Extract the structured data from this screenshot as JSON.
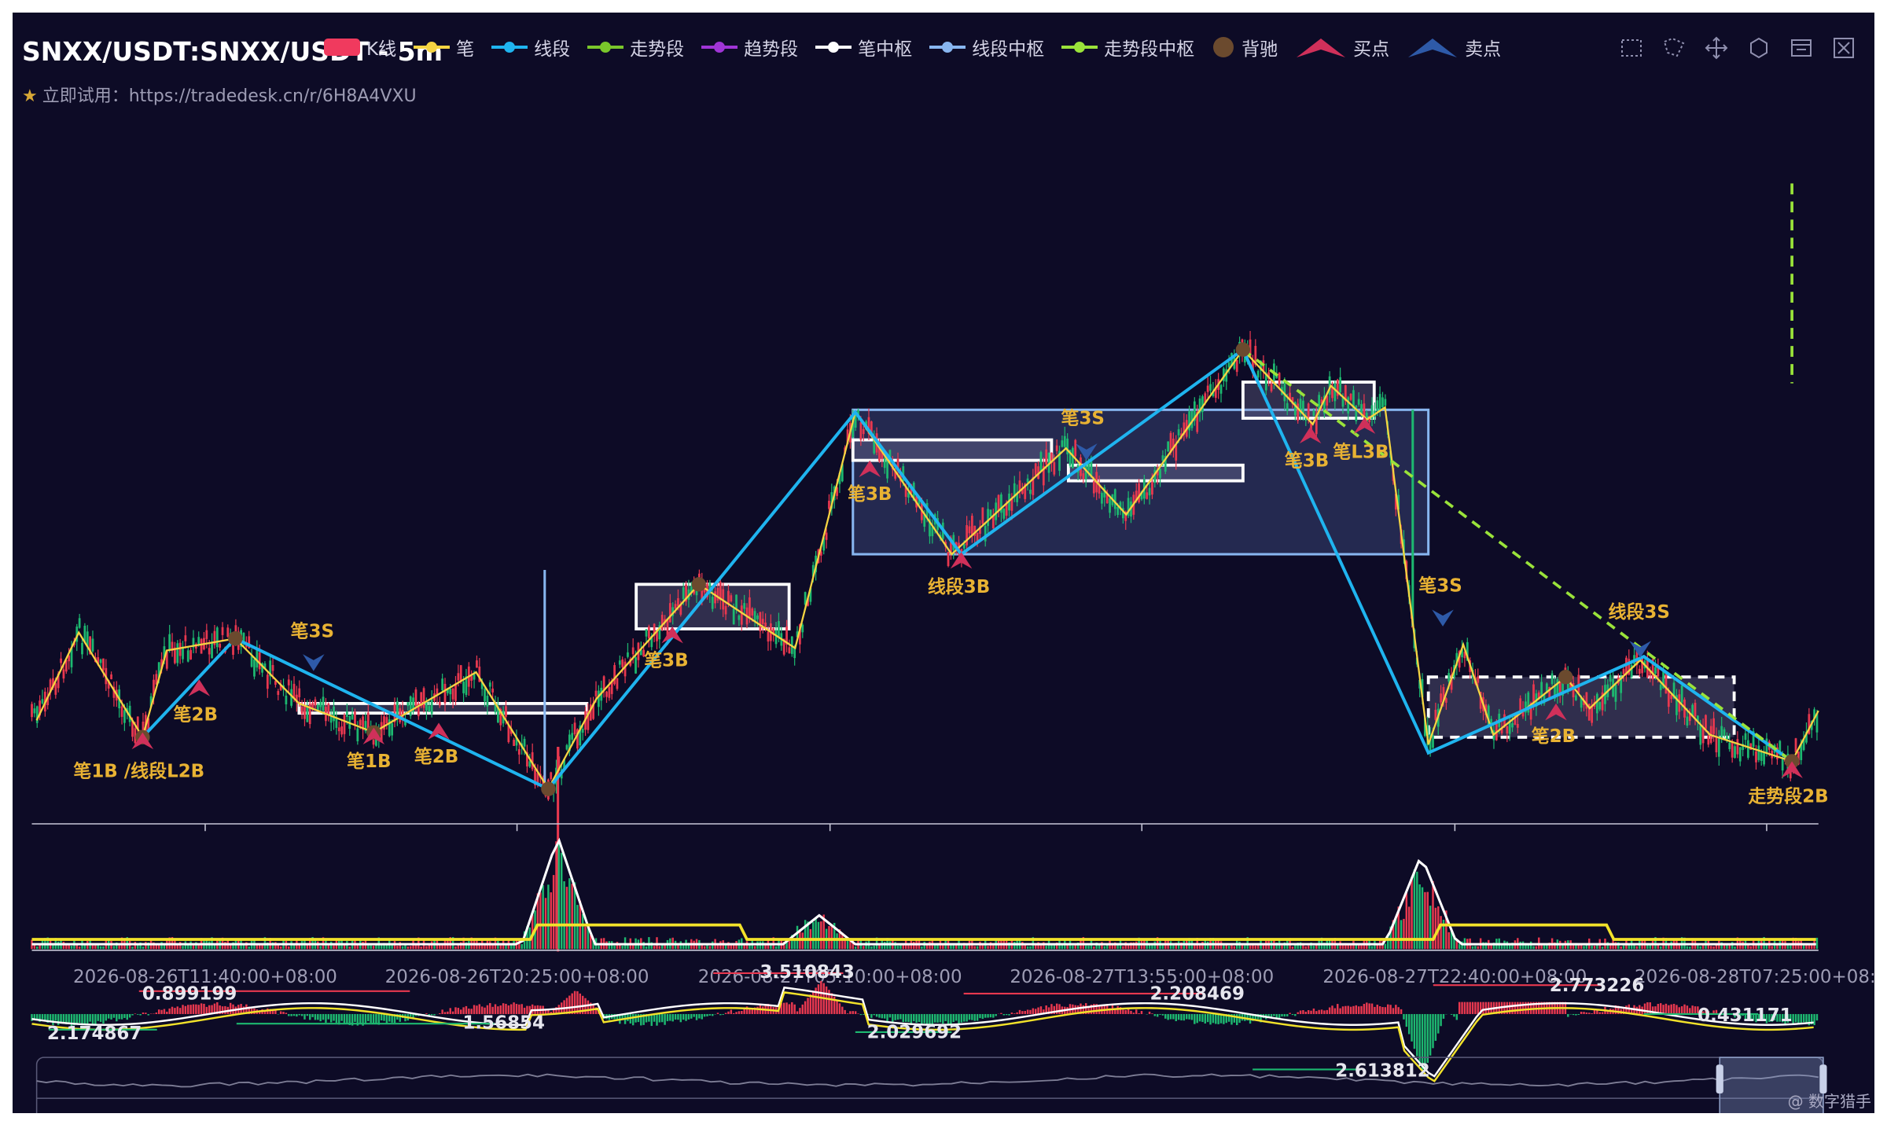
{
  "title": "SNXX/USDT:SNXX/USDT - 5m",
  "subtitle": "立即试用：https://tradedesk.cn/r/6H8A4VXU",
  "watermark": "@ 数字猎手",
  "legend": [
    {
      "label": "K线",
      "color": "#f03a5e",
      "shape": "rect"
    },
    {
      "label": "笔",
      "color": "#f5d442",
      "shape": "line"
    },
    {
      "label": "线段",
      "color": "#1fb4ef",
      "shape": "line"
    },
    {
      "label": "走势段",
      "color": "#7ac72b",
      "shape": "line"
    },
    {
      "label": "趋势段",
      "color": "#a035d6",
      "shape": "line"
    },
    {
      "label": "笔中枢",
      "color": "#ffffff",
      "shape": "line"
    },
    {
      "label": "线段中枢",
      "color": "#88b6f0",
      "shape": "line"
    },
    {
      "label": "走势段中枢",
      "color": "#9ae33a",
      "shape": "line"
    },
    {
      "label": "背驰",
      "color": "#6b4a2e",
      "shape": "dot"
    },
    {
      "label": "买点",
      "color": "#d0305a",
      "shape": "up"
    },
    {
      "label": "卖点",
      "color": "#2e5aa8",
      "shape": "down"
    }
  ],
  "toolbar": [
    {
      "name": "box-zoom-icon"
    },
    {
      "name": "lasso-icon"
    },
    {
      "name": "drag-icon"
    },
    {
      "name": "restore-icon"
    },
    {
      "name": "data-view-icon"
    },
    {
      "name": "clear-icon"
    }
  ],
  "chart_data": {
    "type": "candlestick",
    "x_ticks": [
      "2026-08-26T11:40:00+08:00",
      "2026-08-26T20:25:00+08:00",
      "2026-08-27T05:10:00+08:00",
      "2026-08-27T13:55:00+08:00",
      "2026-08-27T22:40:00+08:00",
      "2026-08-28T07:25:00+08:00"
    ],
    "bi": [
      [
        30,
        598
      ],
      [
        65,
        525
      ],
      [
        118,
        612
      ],
      [
        138,
        540
      ],
      [
        195,
        530
      ],
      [
        248,
        584
      ],
      [
        310,
        608
      ],
      [
        395,
        558
      ],
      [
        455,
        655
      ],
      [
        495,
        580
      ],
      [
        580,
        485
      ],
      [
        660,
        538
      ],
      [
        710,
        342
      ],
      [
        790,
        460
      ],
      [
        885,
        372
      ],
      [
        935,
        427
      ],
      [
        1032,
        290
      ],
      [
        1090,
        352
      ],
      [
        1105,
        320
      ],
      [
        1135,
        348
      ],
      [
        1150,
        338
      ],
      [
        1186,
        618
      ],
      [
        1215,
        535
      ],
      [
        1240,
        610
      ],
      [
        1300,
        562
      ],
      [
        1320,
        588
      ],
      [
        1362,
        548
      ],
      [
        1420,
        610
      ],
      [
        1488,
        632
      ],
      [
        1510,
        590
      ]
    ],
    "xianduan": [
      [
        118,
        612
      ],
      [
        195,
        530
      ],
      [
        455,
        655
      ],
      [
        710,
        342
      ],
      [
        798,
        460
      ],
      [
        1032,
        290
      ],
      [
        1186,
        625
      ],
      [
        1365,
        545
      ],
      [
        1488,
        632
      ]
    ],
    "zoushi_trend": [
      [
        1032,
        290
      ],
      [
        1488,
        632
      ]
    ],
    "bi_zhongshu": [
      {
        "x1": 248,
        "y1": 584,
        "x2": 487,
        "y2": 592,
        "dashed": false
      },
      {
        "x1": 528,
        "y1": 485,
        "x2": 655,
        "y2": 522,
        "dashed": false
      },
      {
        "x1": 708,
        "y1": 365,
        "x2": 873,
        "y2": 382,
        "dashed": false
      },
      {
        "x1": 887,
        "y1": 386,
        "x2": 1032,
        "y2": 399,
        "dashed": false
      },
      {
        "x1": 1032,
        "y1": 317,
        "x2": 1141,
        "y2": 347,
        "dashed": false
      },
      {
        "x1": 1186,
        "y1": 562,
        "x2": 1440,
        "y2": 612,
        "dashed": true
      }
    ],
    "xianduan_zhongshu": [
      {
        "x1": 708,
        "y1": 340,
        "x2": 1186,
        "y2": 460
      }
    ],
    "beichi": [
      [
        118,
        612
      ],
      [
        195,
        530
      ],
      [
        310,
        608
      ],
      [
        455,
        655
      ],
      [
        580,
        485
      ],
      [
        1032,
        290
      ],
      [
        1300,
        562
      ],
      [
        1488,
        632
      ]
    ],
    "buy_points": [
      {
        "x": 118,
        "y": 612,
        "label": "笔1B /线段L2B",
        "lx": 115,
        "ly": 645
      },
      {
        "x": 165,
        "y": 568,
        "label": "笔2B",
        "lx": 162,
        "ly": 598
      },
      {
        "x": 310,
        "y": 608,
        "label": "笔1B",
        "lx": 306,
        "ly": 637
      },
      {
        "x": 364,
        "y": 604,
        "label": "笔2B",
        "lx": 362,
        "ly": 633
      },
      {
        "x": 558,
        "y": 524,
        "label": "笔3B",
        "lx": 553,
        "ly": 553
      },
      {
        "x": 722,
        "y": 386,
        "label": "笔3B",
        "lx": 722,
        "ly": 415
      },
      {
        "x": 798,
        "y": 462,
        "label": "线段3B",
        "lx": 796,
        "ly": 492
      },
      {
        "x": 1088,
        "y": 358,
        "label": "笔3B",
        "lx": 1085,
        "ly": 387
      },
      {
        "x": 1133,
        "y": 350,
        "label": "笔L3B",
        "lx": 1130,
        "ly": 380
      },
      {
        "x": 1292,
        "y": 588,
        "label": "笔2B",
        "lx": 1290,
        "ly": 616
      },
      {
        "x": 1488,
        "y": 636,
        "label": "走势段2B",
        "lx": 1485,
        "ly": 666
      }
    ],
    "sell_points": [
      {
        "x": 260,
        "y": 553,
        "label": "笔3S",
        "lx": 259,
        "ly": 529
      },
      {
        "x": 902,
        "y": 378,
        "label": "笔3S",
        "lx": 899,
        "ly": 352
      },
      {
        "x": 1198,
        "y": 516,
        "label": "笔3S",
        "lx": 1196,
        "ly": 491
      },
      {
        "x": 1362,
        "y": 542,
        "label": "线段3S",
        "lx": 1361,
        "ly": 513
      }
    ],
    "macd_labels": [
      {
        "text": "0.899199",
        "x": 157,
        "y": 825
      },
      {
        "text": "2.174867",
        "x": 78,
        "y": 858
      },
      {
        "text": "1.56854",
        "x": 418,
        "y": 849
      },
      {
        "text": "3.510843",
        "x": 670,
        "y": 807
      },
      {
        "text": "2.029692",
        "x": 759,
        "y": 857
      },
      {
        "text": "2.208469",
        "x": 994,
        "y": 825
      },
      {
        "text": "2.773226",
        "x": 1326,
        "y": 818
      },
      {
        "text": "0.431171",
        "x": 1449,
        "y": 843
      },
      {
        "text": "2.613812",
        "x": 1148,
        "y": 889
      }
    ],
    "volume_spikes": [
      [
        463,
        695
      ],
      [
        680,
        760
      ],
      [
        1180,
        710
      ]
    ]
  }
}
